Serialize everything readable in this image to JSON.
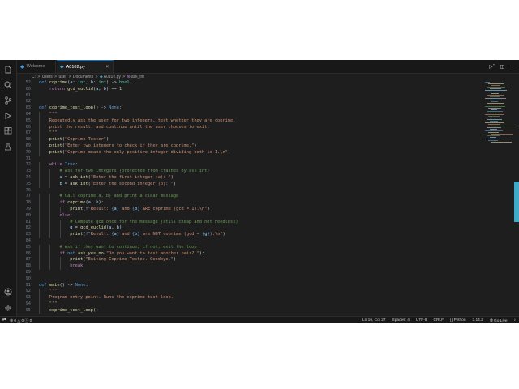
{
  "tabs": {
    "welcome_label": "Welcome",
    "welcome_icon": "vscode-logo-icon",
    "active_label": "A0102.py",
    "active_icon": "python-file-icon",
    "close_glyph": "×"
  },
  "breadcrumb": [
    "C:",
    "Users",
    "user",
    "Documents",
    "A0102.py",
    "ask_int"
  ],
  "breadcrumb_sep": ">",
  "editor": {
    "lines": [
      {
        "n": "52",
        "html": "<span class=\"k\">def</span> <span class=\"f\">coprime</span>(<span class=\"v\">a</span>: <span class=\"t\">int</span>, <span class=\"v\">b</span>: <span class=\"t\">int</span>) -> <span class=\"t\">bool</span>:"
      },
      {
        "n": "60",
        "html": "    <span class=\"p\">return</span> <span class=\"f\">gcd_euclid</span>(<span class=\"v\">a</span>, <span class=\"v\">b</span>) == <span class=\"n\">1</span>"
      },
      {
        "n": "61",
        "html": ""
      },
      {
        "n": "62",
        "html": ""
      },
      {
        "n": "63",
        "html": "<span class=\"k\">def</span> <span class=\"f\">coprime_test_loop</span>() -> <span class=\"k\">None</span>:"
      },
      {
        "n": "64",
        "html": "    <span class=\"s\">\"\"\"</span>"
      },
      {
        "n": "65",
        "html": "<span class=\"s\">    Repeatedly ask the user for two integers, test whether they are coprime,</span>"
      },
      {
        "n": "66",
        "html": "<span class=\"s\">    print the result, and continue until the user chooses to exit.</span>"
      },
      {
        "n": "67",
        "html": "    <span class=\"s\">\"\"\"</span>"
      },
      {
        "n": "68",
        "html": "    <span class=\"f\">print</span>(<span class=\"s\">\"Coprime Tester\"</span>)"
      },
      {
        "n": "69",
        "html": "    <span class=\"f\">print</span>(<span class=\"s\">\"Enter two integers to check if they are coprime.\"</span>)"
      },
      {
        "n": "70",
        "html": "    <span class=\"f\">print</span>(<span class=\"s\">\"Coprime means the only positive integer dividing both is 1.\\n\"</span>)"
      },
      {
        "n": "71",
        "html": ""
      },
      {
        "n": "72",
        "html": "    <span class=\"p\">while</span> <span class=\"k\">True</span>:"
      },
      {
        "n": "73",
        "html": "        <span class=\"c\"># Ask for two integers (protected from crashes by ask_int)</span>"
      },
      {
        "n": "74",
        "html": "        <span class=\"v\">a</span> = <span class=\"f\">ask_int</span>(<span class=\"s\">\"Enter the first integer (a): \"</span>)"
      },
      {
        "n": "75",
        "html": "        <span class=\"v\">b</span> = <span class=\"f\">ask_int</span>(<span class=\"s\">\"Enter the second integer (b): \"</span>)"
      },
      {
        "n": "76",
        "html": ""
      },
      {
        "n": "77",
        "html": "        <span class=\"c\"># Call coprime(a, b) and print a clear message</span>"
      },
      {
        "n": "78",
        "html": "        <span class=\"p\">if</span> <span class=\"f\">coprime</span>(<span class=\"v\">a</span>, <span class=\"v\">b</span>):"
      },
      {
        "n": "79",
        "html": "            <span class=\"f\">print</span>(<span class=\"k\">f</span><span class=\"s\">\"Result: </span><span class=\"k\">{</span><span class=\"v\">a</span><span class=\"k\">}</span><span class=\"s\"> and </span><span class=\"k\">{</span><span class=\"v\">b</span><span class=\"k\">}</span><span class=\"s\"> ARE coprime (gcd = 1).\\n\"</span>)"
      },
      {
        "n": "80",
        "html": "        <span class=\"p\">else</span>:"
      },
      {
        "n": "81",
        "html": "            <span class=\"c\"># Compute gcd once for the message (still cheap and not needless)</span>"
      },
      {
        "n": "82",
        "html": "            <span class=\"v\">g</span> = <span class=\"f\">gcd_euclid</span>(<span class=\"v\">a</span>, <span class=\"v\">b</span>)"
      },
      {
        "n": "83",
        "html": "            <span class=\"f\">print</span>(<span class=\"k\">f</span><span class=\"s\">\"Result: </span><span class=\"k\">{</span><span class=\"v\">a</span><span class=\"k\">}</span><span class=\"s\"> and </span><span class=\"k\">{</span><span class=\"v\">b</span><span class=\"k\">}</span><span class=\"s\"> are NOT coprime (gcd = </span><span class=\"k\">{</span><span class=\"v\">g</span><span class=\"k\">}</span><span class=\"s\">).\\n\"</span>)"
      },
      {
        "n": "84",
        "html": ""
      },
      {
        "n": "85",
        "html": "        <span class=\"c\"># Ask if they want to continue; if not, exit the loop</span>"
      },
      {
        "n": "86",
        "html": "        <span class=\"p\">if</span> <span class=\"k\">not</span> <span class=\"f\">ask_yes_no</span>(<span class=\"s\">\"Do you want to test another pair? \"</span>):"
      },
      {
        "n": "87",
        "html": "            <span class=\"f\">print</span>(<span class=\"s\">\"Exiting Coprime Tester. Goodbye.\"</span>)"
      },
      {
        "n": "88",
        "html": "            <span class=\"p\">break</span>"
      },
      {
        "n": "89",
        "html": ""
      },
      {
        "n": "90",
        "html": ""
      },
      {
        "n": "91",
        "html": "<span class=\"k\">def</span> <span class=\"f\">main</span>() -> <span class=\"k\">None</span>:"
      },
      {
        "n": "92",
        "html": "    <span class=\"s\">\"\"\"</span>"
      },
      {
        "n": "93",
        "html": "<span class=\"s\">    Program entry point. Runs the coprime test loop.</span>"
      },
      {
        "n": "94",
        "html": "    <span class=\"s\">\"\"\"</span>"
      },
      {
        "n": "95",
        "html": "    <span class=\"f\">coprime_test_loop</span>()"
      }
    ]
  },
  "statusbar": {
    "left": {
      "remote_icon": "remote-icon",
      "errors": "0",
      "warnings": "0",
      "info": "0"
    },
    "position": "Ln 16, Col 27",
    "spaces": "Spaces: 4",
    "encoding": "UTF-8",
    "eol": "CRLF",
    "language": "Python",
    "version": "3.14.2",
    "golive": "Go Live"
  },
  "colors": {
    "accent": "#0078d4",
    "background": "#1e1e1e"
  }
}
